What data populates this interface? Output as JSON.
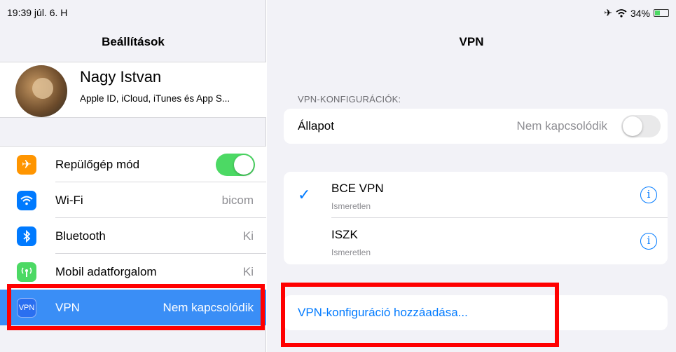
{
  "status_bar": {
    "time_date": "19:39  júl. 6. H",
    "icons": [
      "airplane-icon",
      "wifi-icon"
    ],
    "battery": "34%"
  },
  "sidebar": {
    "title": "Beállítások",
    "profile": {
      "name": "Nagy Istvan",
      "subtitle": "Apple ID, iCloud, iTunes és App S..."
    },
    "items": [
      {
        "label": "Repülőgép mód",
        "icon": "airplane-icon",
        "icon_color": "#ff9500",
        "toggle": "on"
      },
      {
        "label": "Wi-Fi",
        "value": "bicom",
        "icon": "wifi-icon",
        "icon_color": "#007aff"
      },
      {
        "label": "Bluetooth",
        "value": "Ki",
        "icon": "bluetooth-icon",
        "icon_color": "#007aff"
      },
      {
        "label": "Mobil adatforgalom",
        "value": "Ki",
        "icon": "cellular-icon",
        "icon_color": "#4cd964"
      },
      {
        "label": "VPN",
        "value": "Nem kapcsolódik",
        "icon": "vpn-icon",
        "icon_text": "VPN",
        "icon_color": "#2a6ff0",
        "selected": true
      }
    ]
  },
  "detail": {
    "title": "VPN",
    "section_header": "VPN-KONFIGURÁCIÓK:",
    "status": {
      "label": "Állapot",
      "value": "Nem kapcsolódik",
      "toggle": "off"
    },
    "configs": [
      {
        "name": "BCE VPN",
        "status": "Ismeretlen",
        "checked": true
      },
      {
        "name": "ISZK",
        "status": "Ismeretlen",
        "checked": false
      }
    ],
    "add_label": "VPN-konfiguráció hozzáadása..."
  },
  "colors": {
    "accent": "#007aff",
    "selection": "#3a8ef6",
    "highlight_box": "#ff0000",
    "toggle_on": "#4cd964"
  }
}
